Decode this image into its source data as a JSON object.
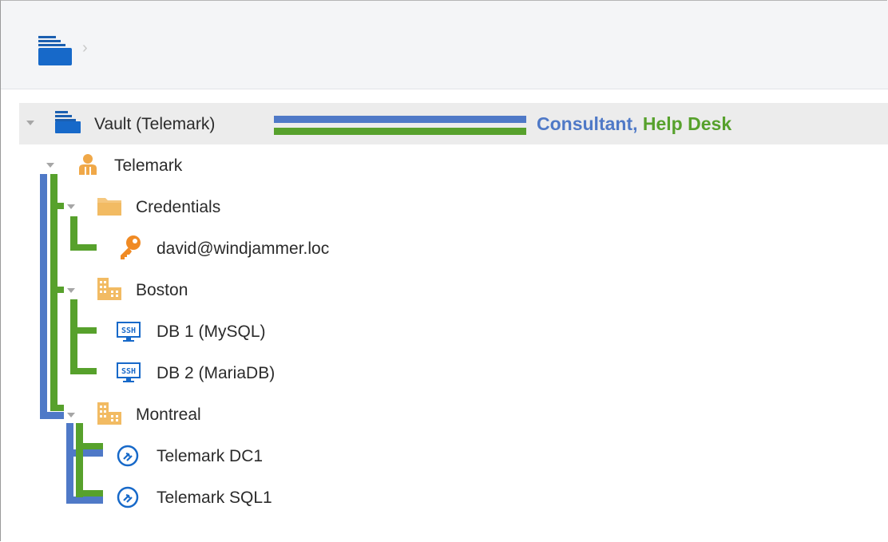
{
  "toolbar": {
    "root_icon": "vault-folder-icon",
    "breadcrumb_separator": "›"
  },
  "tree": {
    "vault": {
      "label": "Vault (Telemark)",
      "icon": "vault-folder-icon"
    },
    "roles": {
      "first": "Consultant,",
      "second": " Help Desk"
    },
    "nodes": [
      {
        "label": "Telemark",
        "icon": "user-icon"
      },
      {
        "label": "Credentials",
        "icon": "folder-icon"
      },
      {
        "label": "david@windjammer.loc",
        "icon": "key-icon"
      },
      {
        "label": "Boston",
        "icon": "building-icon"
      },
      {
        "label": "DB 1 (MySQL)",
        "icon": "ssh-icon"
      },
      {
        "label": "DB 2 (MariaDB)",
        "icon": "ssh-icon"
      },
      {
        "label": "Montreal",
        "icon": "building-icon"
      },
      {
        "label": "Telemark DC1",
        "icon": "rdp-icon"
      },
      {
        "label": "Telemark SQL1",
        "icon": "rdp-icon"
      }
    ]
  },
  "colors": {
    "blue": "#4f79c7",
    "green": "#57a12c",
    "orange": "#f08a24",
    "folder": "#f5c77e"
  }
}
